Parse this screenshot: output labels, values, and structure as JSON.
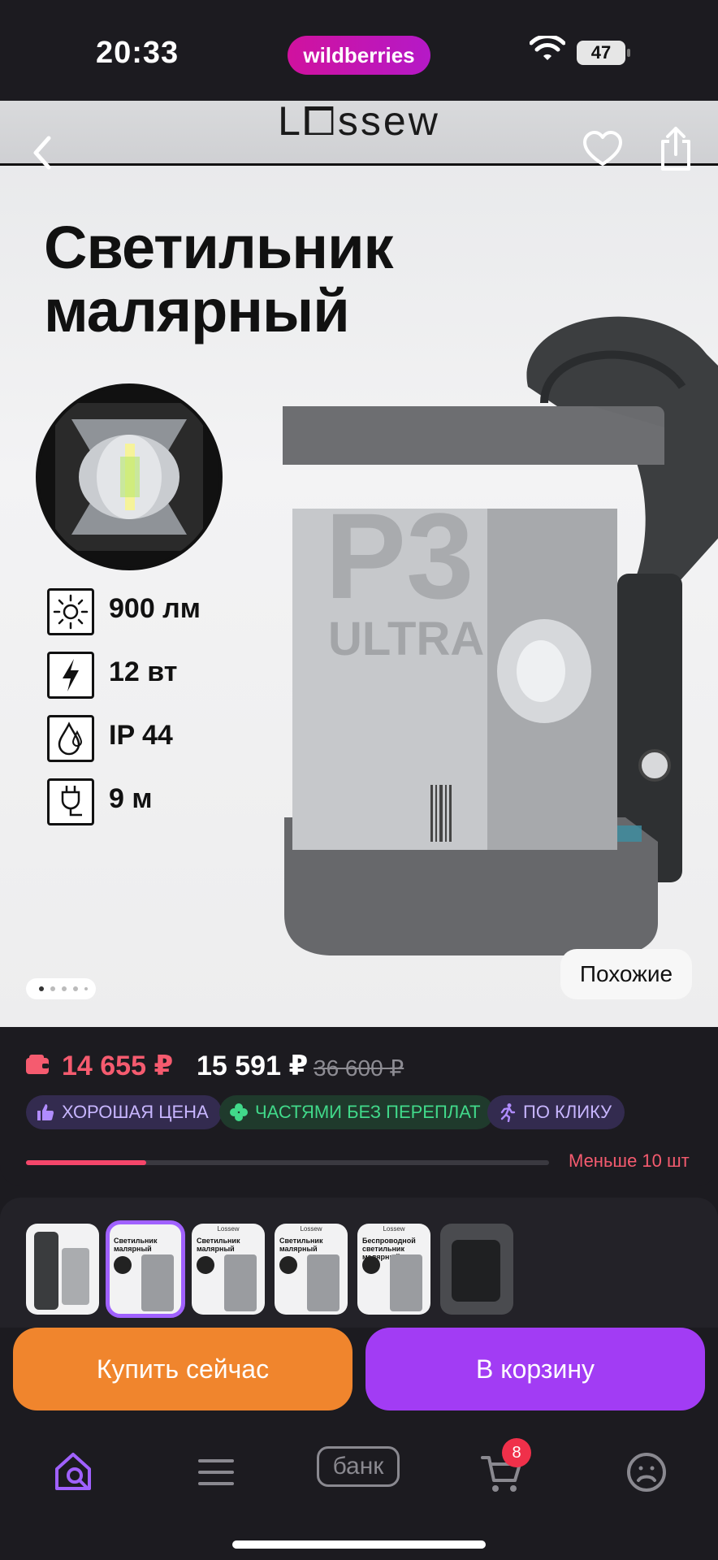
{
  "status_bar": {
    "time": "20:33",
    "app_pill": "wildberries",
    "battery": "47"
  },
  "product": {
    "brand": "L⧠ssew",
    "title": "Светильник малярный",
    "specs": [
      {
        "icon": "sun-icon",
        "text": "900 лм"
      },
      {
        "icon": "lightning-icon",
        "text": "12 вт"
      },
      {
        "icon": "water-drop-icon",
        "text": "IP 44"
      },
      {
        "icon": "plug-icon",
        "text": "9 м"
      }
    ],
    "product_label": {
      "model": "P3",
      "line": "ULTRA"
    },
    "gallery_position": "1 of 5",
    "similar_label": "Похожие"
  },
  "price": {
    "wallet_price": "14 655 ₽",
    "price": "15 591 ₽",
    "old_price": "36 600 ₽",
    "badges": [
      {
        "icon": "thumbs-up-icon",
        "text": "ХОРОШАЯ ЦЕНА"
      },
      {
        "icon": "clover-icon",
        "text": "ЧАСТЯМИ БЕЗ ПЕРЕПЛАТ"
      },
      {
        "icon": "running-icon",
        "text": "ПО КЛИКУ"
      }
    ],
    "stock_fraction": 0.23,
    "stock_text": "Меньше 10 шт"
  },
  "thumbnails": [
    {
      "title": "",
      "brand": ""
    },
    {
      "title": "Светильник малярный",
      "brand": ""
    },
    {
      "title": "Светильник малярный",
      "brand": "Lossew"
    },
    {
      "title": "Светильник малярный",
      "brand": "Lossew"
    },
    {
      "title": "Беспроводной светильник малярный",
      "brand": "Lossew"
    },
    {
      "title": "",
      "brand": ""
    }
  ],
  "actions": {
    "buy_now": "Купить сейчас",
    "add_to_cart": "В корзину"
  },
  "tabbar": {
    "bank_label": "банк",
    "cart_count": "8"
  },
  "colors": {
    "accent": "#a23cf4",
    "buy": "#f0852d",
    "price_red": "#f55b6f",
    "brand_pink": "#cb11ab"
  }
}
